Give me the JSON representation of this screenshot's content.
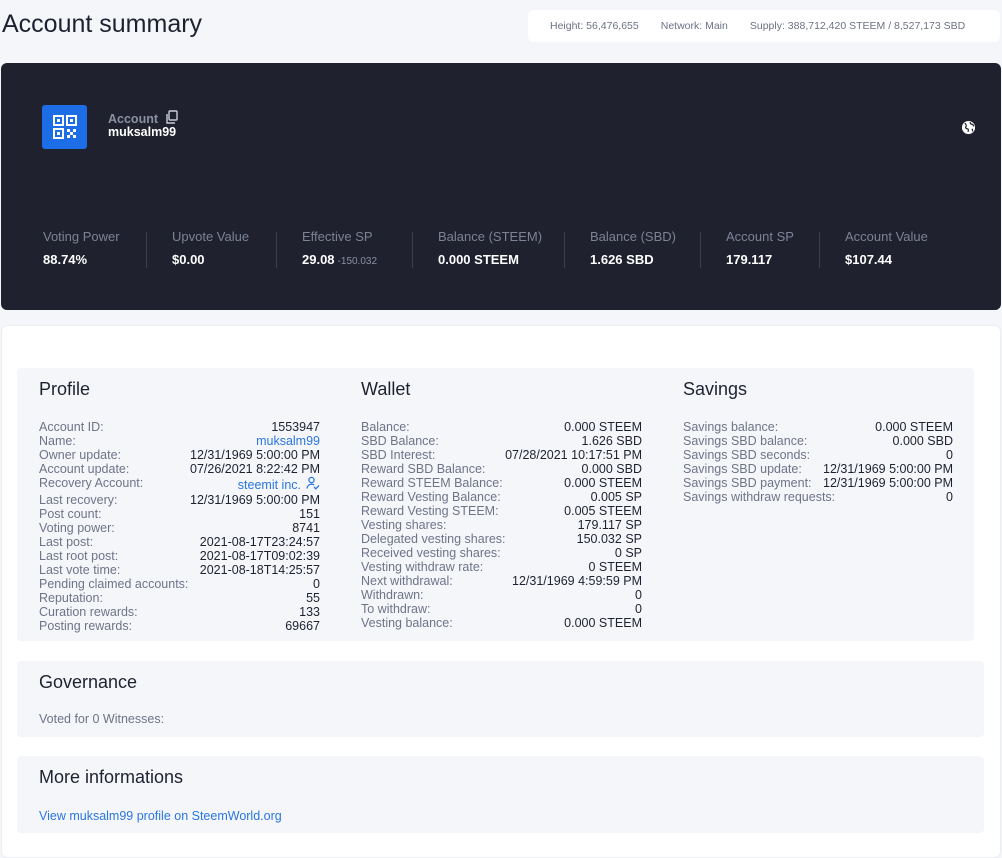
{
  "header": {
    "title": "Account summary",
    "height": "Height: 56,476,655",
    "network": "Network: Main",
    "supply": "Supply: 388,712,420 STEEM / 8,527,173 SBD"
  },
  "account": {
    "label": "Account",
    "name": "muksalm99"
  },
  "metrics": [
    {
      "label": "Voting Power",
      "value": "88.74%",
      "sub": ""
    },
    {
      "label": "Upvote Value",
      "value": "$0.00",
      "sub": ""
    },
    {
      "label": "Effective SP",
      "value": "29.08",
      "sub": "-150.032"
    },
    {
      "label": "Balance (STEEM)",
      "value": "0.000 STEEM",
      "sub": ""
    },
    {
      "label": "Balance (SBD)",
      "value": "1.626 SBD",
      "sub": ""
    },
    {
      "label": "Account SP",
      "value": "179.117",
      "sub": ""
    },
    {
      "label": "Account Value",
      "value": "$107.44",
      "sub": ""
    }
  ],
  "profile": {
    "title": "Profile",
    "rows": [
      {
        "k": "Account ID:",
        "v": "1553947"
      },
      {
        "k": "Name:",
        "v": "muksalm99"
      },
      {
        "k": "Owner update:",
        "v": "12/31/1969 5:00:00 PM"
      },
      {
        "k": "Account update:",
        "v": "07/26/2021 8:22:42 PM"
      },
      {
        "k": "Recovery Account:",
        "v": "steemit inc."
      },
      {
        "k": "Last recovery:",
        "v": "12/31/1969 5:00:00 PM"
      },
      {
        "k": "Post count:",
        "v": "151"
      },
      {
        "k": "Voting power:",
        "v": "8741"
      },
      {
        "k": "Last post:",
        "v": "2021-08-17T23:24:57"
      },
      {
        "k": "Last root post:",
        "v": "2021-08-17T09:02:39"
      },
      {
        "k": "Last vote time:",
        "v": "2021-08-18T14:25:57"
      },
      {
        "k": "Pending claimed accounts:",
        "v": "0"
      },
      {
        "k": "Reputation:",
        "v": "55"
      },
      {
        "k": "Curation rewards:",
        "v": "133"
      },
      {
        "k": "Posting rewards:",
        "v": "69667"
      }
    ]
  },
  "wallet": {
    "title": "Wallet",
    "rows": [
      {
        "k": "Balance:",
        "v": "0.000 STEEM"
      },
      {
        "k": "SBD Balance:",
        "v": "1.626 SBD"
      },
      {
        "k": "SBD Interest:",
        "v": "07/28/2021 10:17:51 PM"
      },
      {
        "k": "Reward SBD Balance:",
        "v": "0.000 SBD"
      },
      {
        "k": "Reward STEEM Balance:",
        "v": "0.000 STEEM"
      },
      {
        "k": "Reward Vesting Balance:",
        "v": "0.005 SP"
      },
      {
        "k": "Reward Vesting STEEM:",
        "v": "0.005 STEEM"
      },
      {
        "k": "Vesting shares:",
        "v": "179.117 SP"
      },
      {
        "k": "Delegated vesting shares:",
        "v": "150.032 SP"
      },
      {
        "k": "Received vesting shares:",
        "v": "0 SP"
      },
      {
        "k": "Vesting withdraw rate:",
        "v": "0 STEEM"
      },
      {
        "k": "Next withdrawal:",
        "v": "12/31/1969 4:59:59 PM"
      },
      {
        "k": "Withdrawn:",
        "v": "0"
      },
      {
        "k": "To withdraw:",
        "v": "0"
      },
      {
        "k": "Vesting balance:",
        "v": "0.000 STEEM"
      }
    ]
  },
  "savings": {
    "title": "Savings",
    "rows": [
      {
        "k": "Savings balance:",
        "v": "0.000 STEEM"
      },
      {
        "k": "Savings SBD balance:",
        "v": "0.000 SBD"
      },
      {
        "k": "Savings SBD seconds:",
        "v": "0"
      },
      {
        "k": "Savings SBD update:",
        "v": "12/31/1969 5:00:00 PM"
      },
      {
        "k": "Savings SBD payment:",
        "v": "12/31/1969 5:00:00 PM"
      },
      {
        "k": "Savings withdraw requests:",
        "v": "0"
      }
    ]
  },
  "governance": {
    "title": "Governance",
    "text": "Voted for 0 Witnesses:"
  },
  "more": {
    "title": "More informations",
    "link": "View muksalm99 profile on SteemWorld.org"
  },
  "colors": {
    "hero_bg": "#1f222e",
    "accent": "#1d6ee6",
    "link": "#2a76e0"
  },
  "icons": {
    "qr": "qr-code-icon",
    "copy": "copy-icon",
    "globe": "globe-icon",
    "verified": "user-check-icon"
  }
}
